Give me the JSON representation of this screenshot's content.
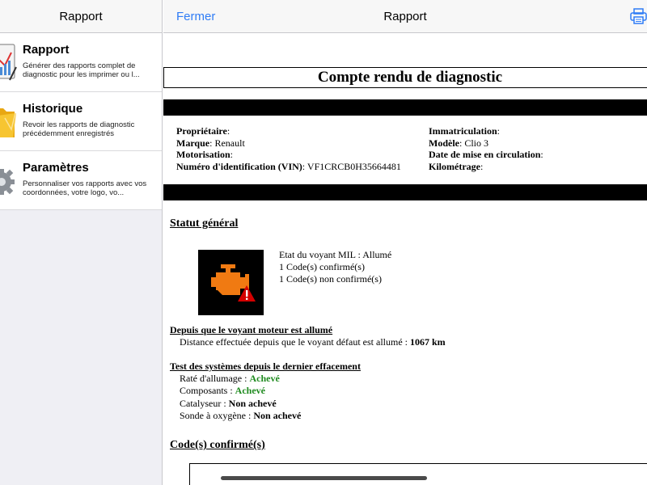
{
  "sidebar": {
    "title": "Rapport",
    "items": [
      {
        "title": "Rapport",
        "desc": "Générer des rapports complet de diagnostic pour les imprimer ou l...",
        "icon": "report-chart-icon"
      },
      {
        "title": "Historique",
        "desc": "Revoir les rapports de diagnostic précédemment enregistrés",
        "icon": "folder-icon"
      },
      {
        "title": "Paramètres",
        "desc": "Personnaliser vos rapports avec vos coordonnées, votre logo, vo...",
        "icon": "gear-icon"
      }
    ]
  },
  "nav": {
    "close_label": "Fermer",
    "title": "Rapport",
    "print_icon": "printer-icon"
  },
  "report": {
    "title": "Compte rendu de diagnostic",
    "vehicle": {
      "owner_label": "Propriétaire",
      "owner_value": "",
      "make_label": "Marque",
      "make_value": "Renault",
      "engine_label": "Motorisation",
      "engine_value": "",
      "vin_label": "Numéro d'identification (VIN)",
      "vin_value": "VF1CRCB0H35664481",
      "plate_label": "Immatriculation",
      "plate_value": "",
      "model_label": "Modèle",
      "model_value": "Clio 3",
      "reg_date_label": "Date de mise en circulation",
      "reg_date_value": "",
      "mileage_label": "Kilométrage",
      "mileage_value": ""
    },
    "general_status": {
      "title": "Statut général",
      "mil_state": "Etat du voyant MIL : Allumé",
      "confirmed_codes": "1 Code(s) confirmé(s)",
      "unconfirmed_codes": "1 Code(s) non confirmé(s)",
      "icon": "check-engine-warning-icon"
    },
    "since_mil": {
      "title": "Depuis que le voyant moteur est allumé",
      "distance_label": "Distance effectuée depuis que le voyant défaut est allumé : ",
      "distance_value": "1067 km"
    },
    "system_tests": {
      "title": "Test des systèmes depuis le dernier effacement",
      "items": [
        {
          "label": "Raté d'allumage : ",
          "value": "Achevé",
          "status": "ok"
        },
        {
          "label": "Composants : ",
          "value": "Achevé",
          "status": "ok"
        },
        {
          "label": "Catalyseur : ",
          "value": "Non achevé",
          "status": "pending"
        },
        {
          "label": "Sonde à oxygène : ",
          "value": "Non achevé",
          "status": "pending"
        }
      ]
    },
    "confirmed_codes_title": "Code(s) confirmé(s)"
  },
  "colors": {
    "accent": "#2f7cf6",
    "ok_green": "#1e8a1e",
    "engine_orange": "#f07a12",
    "warning_red": "#d40000"
  }
}
